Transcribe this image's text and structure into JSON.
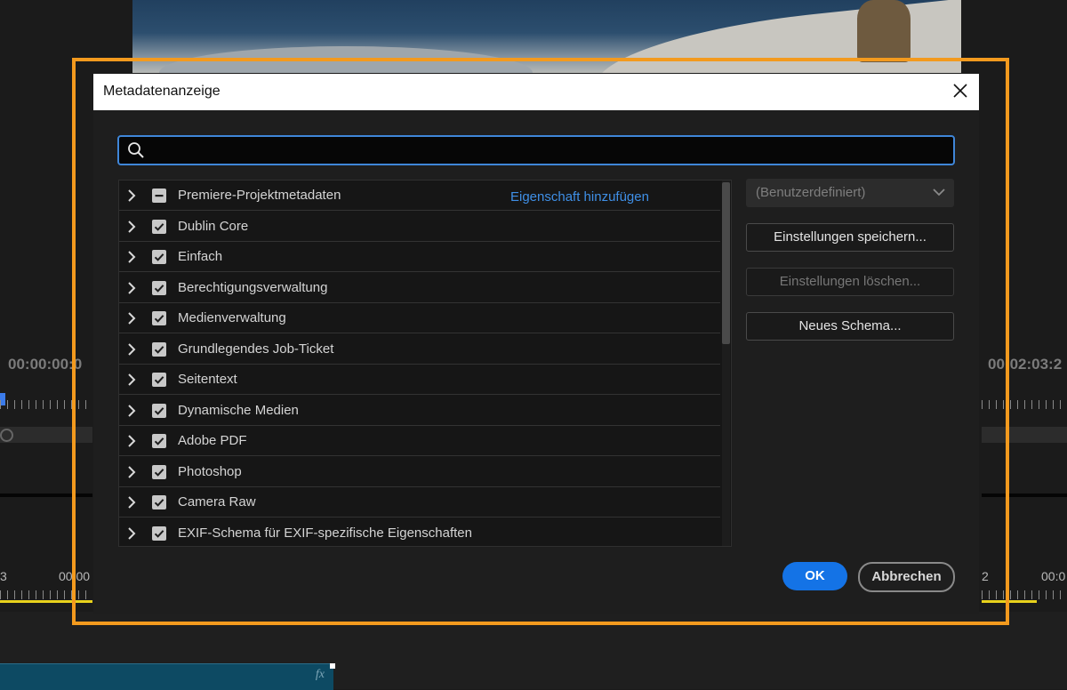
{
  "background": {
    "timecode_left": "00:00:00:0",
    "timecode_right": "00:02:03:2",
    "timeline_labels": [
      "3",
      "00:00",
      "2",
      "00:0"
    ],
    "clip_fx": "fx"
  },
  "dialog": {
    "title": "Metadatenanzeige",
    "search": {
      "value": "",
      "placeholder": ""
    },
    "add_property_link": "Eigenschaft hinzufügen",
    "schemas": [
      {
        "label": "Premiere-Projektmetadaten",
        "state": "mixed"
      },
      {
        "label": "Dublin Core",
        "state": "checked"
      },
      {
        "label": "Einfach",
        "state": "checked"
      },
      {
        "label": "Berechtigungsverwaltung",
        "state": "checked"
      },
      {
        "label": "Medienverwaltung",
        "state": "checked"
      },
      {
        "label": "Grundlegendes Job-Ticket",
        "state": "checked"
      },
      {
        "label": "Seitentext",
        "state": "checked"
      },
      {
        "label": "Dynamische Medien",
        "state": "checked"
      },
      {
        "label": "Adobe PDF",
        "state": "checked"
      },
      {
        "label": "Photoshop",
        "state": "checked"
      },
      {
        "label": "Camera Raw",
        "state": "checked"
      },
      {
        "label": "EXIF-Schema für EXIF-spezifische Eigenschaften",
        "state": "checked"
      }
    ],
    "preset_select": "(Benutzerdefiniert)",
    "save_settings": "Einstellungen speichern...",
    "delete_settings": "Einstellungen löschen...",
    "new_schema": "Neues Schema...",
    "ok": "OK",
    "cancel": "Abbrechen"
  },
  "colors": {
    "highlight": "#f39a1e",
    "accent": "#1473e6",
    "link": "#3f8fe6"
  }
}
